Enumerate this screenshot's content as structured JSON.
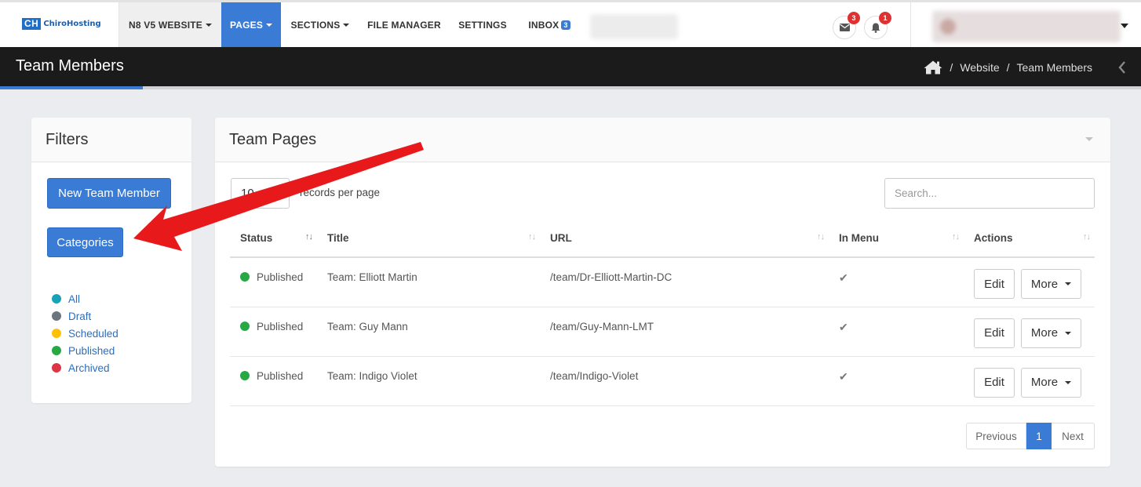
{
  "brand": {
    "logo_mark": "CH",
    "logo_text": "ChiroHosting"
  },
  "nav": {
    "site": "N8 V5 WEBSITE",
    "pages": "PAGES",
    "sections": "SECTIONS",
    "file_manager": "FILE MANAGER",
    "settings": "SETTINGS",
    "inbox": "INBOX",
    "inbox_count": "3"
  },
  "notifications": {
    "mail_count": "3",
    "bell_count": "1"
  },
  "header": {
    "title": "Team Members",
    "breadcrumb": [
      "Website",
      "Team Members"
    ]
  },
  "filters": {
    "title": "Filters",
    "new_button": "New Team Member",
    "categories_button": "Categories",
    "statuses": [
      {
        "label": "All",
        "color": "#17a2b8"
      },
      {
        "label": "Draft",
        "color": "#6c757d"
      },
      {
        "label": "Scheduled",
        "color": "#ffc107"
      },
      {
        "label": "Published",
        "color": "#28a745"
      },
      {
        "label": "Archived",
        "color": "#dc3545"
      }
    ]
  },
  "team_pages": {
    "title": "Team Pages",
    "per_page_value": "10",
    "per_page_label": "records per page",
    "search_placeholder": "Search...",
    "columns": [
      "Status",
      "Title",
      "URL",
      "In Menu",
      "Actions"
    ],
    "rows": [
      {
        "status": "Published",
        "title": "Team: Elliott Martin",
        "url": "/team/Dr-Elliott-Martin-DC",
        "in_menu": true
      },
      {
        "status": "Published",
        "title": "Team: Guy Mann",
        "url": "/team/Guy-Mann-LMT",
        "in_menu": true
      },
      {
        "status": "Published",
        "title": "Team: Indigo Violet",
        "url": "/team/Indigo-Violet",
        "in_menu": true
      }
    ],
    "edit_label": "Edit",
    "more_label": "More",
    "pagination": {
      "previous": "Previous",
      "current": "1",
      "next": "Next"
    }
  },
  "colors": {
    "accent": "#3a7bd5",
    "arrow": "#e8191b",
    "titlebar": "#1b1b1b"
  }
}
